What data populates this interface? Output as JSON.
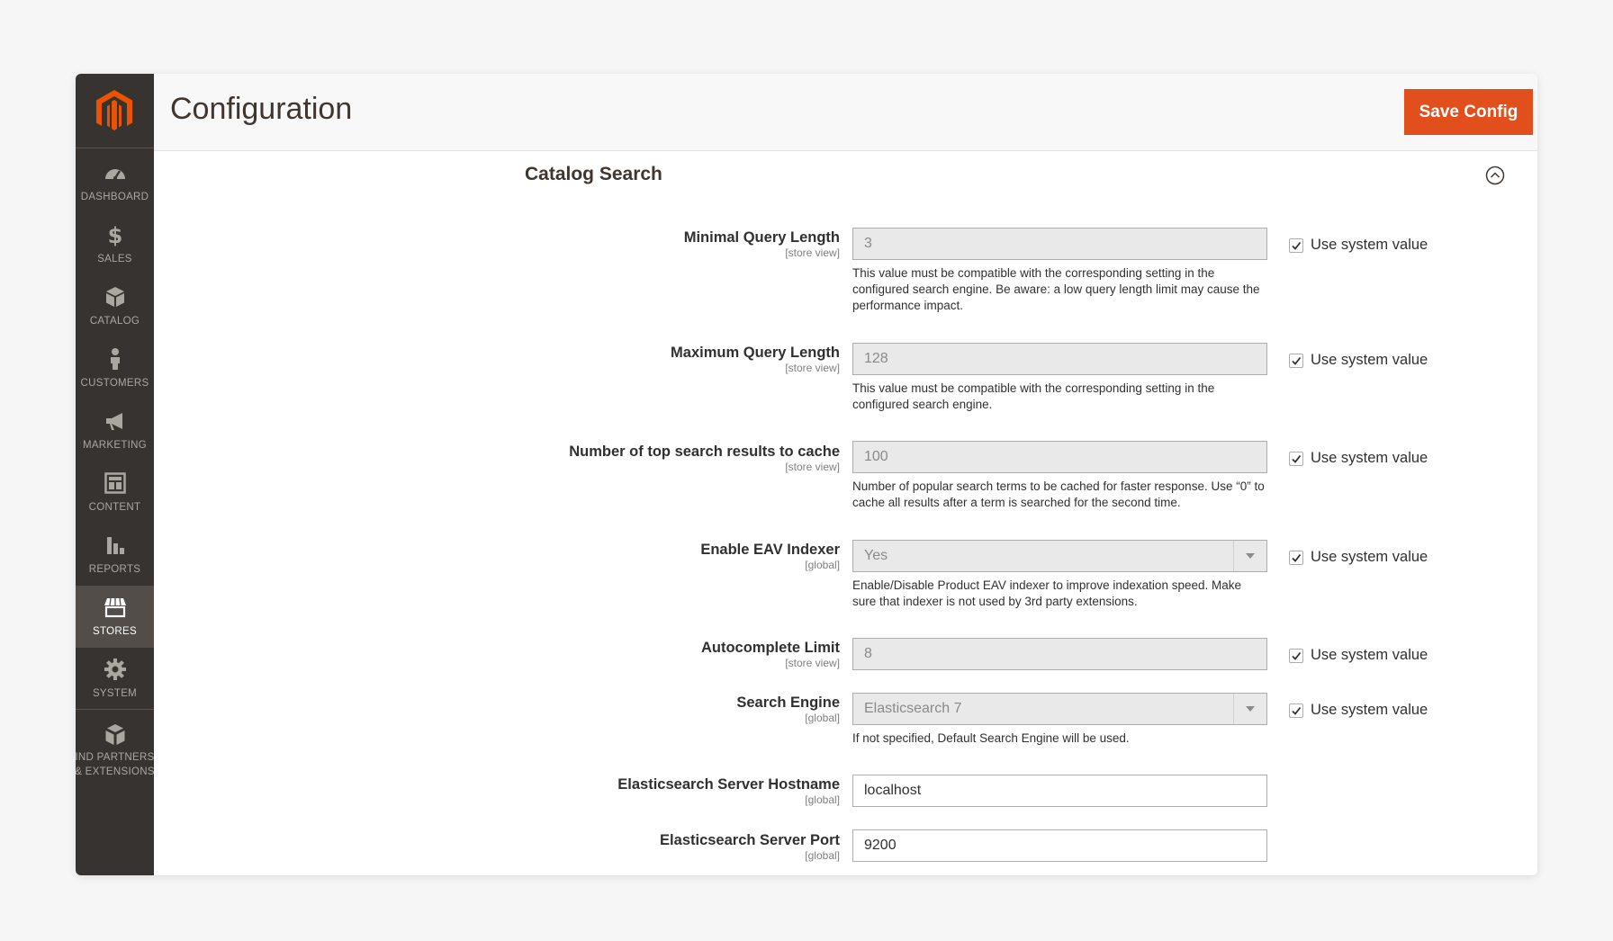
{
  "header": {
    "title": "Configuration",
    "save_label": "Save Config"
  },
  "sidebar": {
    "items": [
      {
        "label": "DASHBOARD",
        "icon": "dashboard-icon"
      },
      {
        "label": "SALES",
        "icon": "dollar-icon"
      },
      {
        "label": "CATALOG",
        "icon": "box-icon"
      },
      {
        "label": "CUSTOMERS",
        "icon": "person-icon"
      },
      {
        "label": "MARKETING",
        "icon": "megaphone-icon"
      },
      {
        "label": "CONTENT",
        "icon": "layout-icon"
      },
      {
        "label": "REPORTS",
        "icon": "bar-chart-icon"
      },
      {
        "label": "STORES",
        "icon": "storefront-icon",
        "active": true
      },
      {
        "label": "SYSTEM",
        "icon": "gear-icon"
      },
      {
        "label_line1": "IND PARTNERS",
        "label_line2": "& EXTENSIONS",
        "icon": "cubes-icon"
      }
    ]
  },
  "section": {
    "title": "Catalog Search"
  },
  "use_system_value_label": "Use system value",
  "rows": [
    {
      "label": "Minimal Query Length",
      "scope": "[store view]",
      "value": "3",
      "note": "This value must be compatible with the corresponding setting in the configured search engine. Be aware: a low query length limit may cause the performance impact."
    },
    {
      "label": "Maximum Query Length",
      "scope": "[store view]",
      "value": "128",
      "note": "This value must be compatible with the corresponding setting in the configured search engine."
    },
    {
      "label": "Number of top search results to cache",
      "scope": "[store view]",
      "value": "100",
      "note": "Number of popular search terms to be cached for faster response. Use “0” to cache all results after a term is searched for the second time."
    },
    {
      "label": "Enable EAV Indexer",
      "scope": "[global]",
      "value": "Yes",
      "note": "Enable/Disable Product EAV indexer to improve indexation speed. Make sure that indexer is not used by 3rd party extensions."
    },
    {
      "label": "Autocomplete Limit",
      "scope": "[store view]",
      "value": "8"
    },
    {
      "label": "Search Engine",
      "scope": "[global]",
      "value": "Elasticsearch 7",
      "note": "If not specified, Default Search Engine will be used."
    },
    {
      "label": "Elasticsearch Server Hostname",
      "scope": "[global]",
      "value": "localhost"
    },
    {
      "label": "Elasticsearch Server Port",
      "scope": "[global]",
      "value": "9200"
    }
  ],
  "colors": {
    "accent": "#e04f1c",
    "sidebar_bg": "#373330",
    "sidebar_active": "#524d49"
  }
}
